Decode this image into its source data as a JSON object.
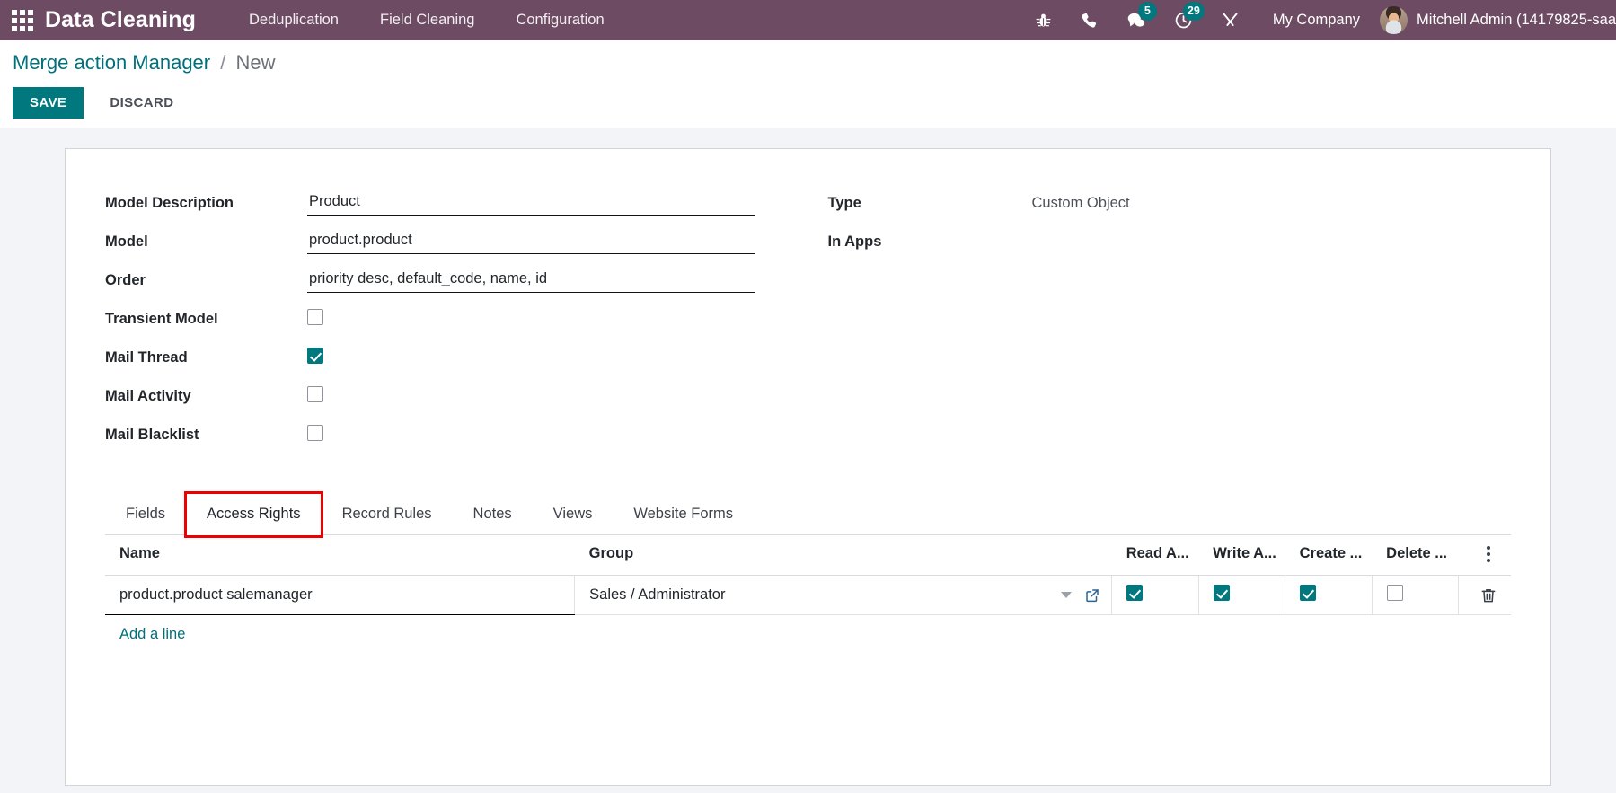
{
  "navbar": {
    "apps_icon": "apps-grid-icon",
    "brand": "Data Cleaning",
    "menus": [
      {
        "label": "Deduplication"
      },
      {
        "label": "Field Cleaning"
      },
      {
        "label": "Configuration"
      }
    ],
    "icons": [
      {
        "name": "bug-icon",
        "badge": null
      },
      {
        "name": "phone-icon",
        "badge": null
      },
      {
        "name": "messages-icon",
        "badge": "5"
      },
      {
        "name": "activities-clock-icon",
        "badge": "29"
      },
      {
        "name": "tools-icon",
        "badge": null
      }
    ],
    "company": "My Company",
    "user": "Mitchell Admin (14179825-saa",
    "avatar": "user-avatar"
  },
  "control_panel": {
    "breadcrumb_root": "Merge action Manager",
    "breadcrumb_separator": "/",
    "breadcrumb_current": "New",
    "save_label": "SAVE",
    "discard_label": "DISCARD"
  },
  "form": {
    "left": [
      {
        "label": "Model Description",
        "type": "text",
        "value": "Product"
      },
      {
        "label": "Model",
        "type": "text",
        "value": "product.product"
      },
      {
        "label": "Order",
        "type": "text",
        "value": "priority desc, default_code, name, id"
      },
      {
        "label": "Transient Model",
        "type": "checkbox",
        "checked": false
      },
      {
        "label": "Mail Thread",
        "type": "checkbox",
        "checked": true
      },
      {
        "label": "Mail Activity",
        "type": "checkbox",
        "checked": false
      },
      {
        "label": "Mail Blacklist",
        "type": "checkbox",
        "checked": false
      }
    ],
    "right": [
      {
        "label": "Type",
        "type": "readonly",
        "value": "Custom Object"
      },
      {
        "label": "In Apps",
        "type": "readonly",
        "value": ""
      }
    ]
  },
  "notebook": {
    "tabs": [
      {
        "label": "Fields",
        "active": false,
        "highlighted": false
      },
      {
        "label": "Access Rights",
        "active": true,
        "highlighted": true
      },
      {
        "label": "Record Rules",
        "active": false,
        "highlighted": false
      },
      {
        "label": "Notes",
        "active": false,
        "highlighted": false
      },
      {
        "label": "Views",
        "active": false,
        "highlighted": false
      },
      {
        "label": "Website Forms",
        "active": false,
        "highlighted": false
      }
    ],
    "highlight_color": "#ee0000"
  },
  "access_rights_table": {
    "columns": [
      "Name",
      "Group",
      "Read A...",
      "Write A...",
      "Create ...",
      "Delete ..."
    ],
    "rows": [
      {
        "name": "product.product salemanager",
        "group": "Sales / Administrator",
        "read_access": true,
        "write_access": true,
        "create_access": true,
        "delete_access": false
      }
    ],
    "add_line_label": "Add a line",
    "options_icon": "vertical-dots-icon",
    "row_delete_icon": "trash-icon",
    "group_dropdown_icon": "chevron-down-icon",
    "group_external_icon": "external-link-icon"
  },
  "theme": {
    "navbar_bg": "#6c4b63",
    "accent_teal": "#00787e",
    "link_teal": "#00707a",
    "page_bg": "#f3f4f7",
    "highlight_red": "#ee0000"
  }
}
